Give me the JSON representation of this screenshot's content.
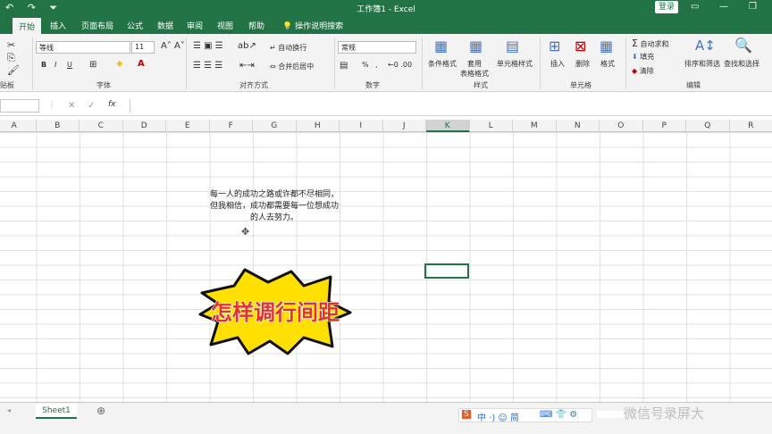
{
  "window": {
    "title": "工作簿1  -  Excel",
    "login": "登录"
  },
  "tabs": [
    "开始",
    "插入",
    "页面布局",
    "公式",
    "数据",
    "审阅",
    "视图",
    "帮助"
  ],
  "tell_me": "操作说明搜索",
  "ribbon": {
    "font_name": "等线",
    "font_size": "11",
    "number_format": "常规",
    "wrap_text": "自动换行",
    "merge_center": "合并后居中",
    "conditional_format": "条件格式",
    "format_table": "套用\n表格格式",
    "cell_styles": "单元格样式",
    "insert": "插入",
    "delete": "删除",
    "format": "格式",
    "autosum": "自动求和",
    "fill": "填充",
    "clear": "清除",
    "sort_filter": "排序和筛选",
    "find_select": "查找和选择",
    "groups": {
      "clipboard": "贴板",
      "font": "字体",
      "alignment": "对齐方式",
      "number": "数字",
      "styles": "样式",
      "cells": "单元格",
      "editing": "编辑"
    },
    "font_btns": {
      "bold": "B",
      "italic": "I",
      "underline": "U"
    },
    "number_btns": {
      "percent": "%",
      "comma": ","
    }
  },
  "formula_bar": {
    "fx": "fx"
  },
  "columns": [
    "A",
    "B",
    "C",
    "D",
    "E",
    "F",
    "G",
    "H",
    "I",
    "J",
    "K",
    "L",
    "M",
    "N",
    "O",
    "P",
    "Q",
    "R"
  ],
  "selected_column": "K",
  "textbox": "每一人的成功之路或许都不尽相同，但我相信，成功都需要每一位想成功的人去努力。",
  "banner": "怎样调行间距",
  "sheet": {
    "name": "Sheet1",
    "add": "⊕"
  },
  "ime": {
    "chars": "中 ·) ☺ 简"
  },
  "watermark": "微信号录屏大"
}
